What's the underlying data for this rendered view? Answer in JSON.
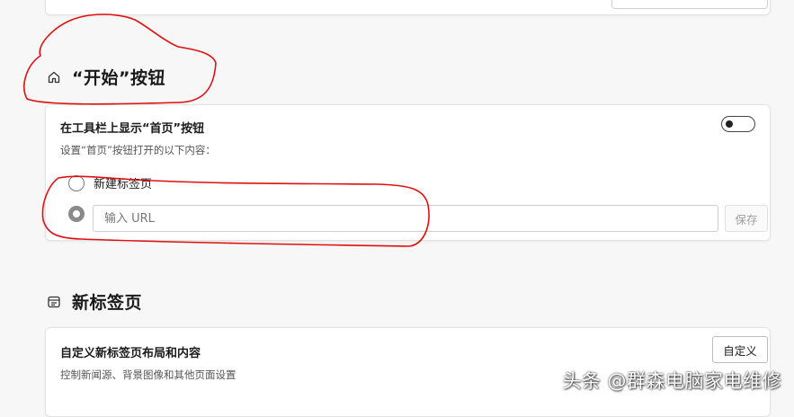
{
  "sections": {
    "start_button": {
      "heading": "“开始”按钮",
      "icon": "home-icon",
      "show_on_toolbar": {
        "title": "在工具栏上显示“首页”按钮",
        "enabled": false
      },
      "subtitle": "设置“首页”按钮打开的以下内容：",
      "options": {
        "new_tab_label": "新建标签页",
        "url_placeholder": "输入 URL",
        "selected": "url"
      },
      "save_label": "保存"
    },
    "new_tab_page": {
      "heading": "新标签页",
      "icon": "newtab-icon",
      "customize": {
        "title": "自定义新标签页布局和内容",
        "subtitle": "控制新闻源、背景图像和其他页面设置",
        "button_label": "自定义"
      }
    }
  },
  "watermark": "头条 @群森电脑家电维修",
  "colors": {
    "annotation_red": "#e01010",
    "card_bg": "#ffffff",
    "page_bg": "#f7f7f7"
  }
}
